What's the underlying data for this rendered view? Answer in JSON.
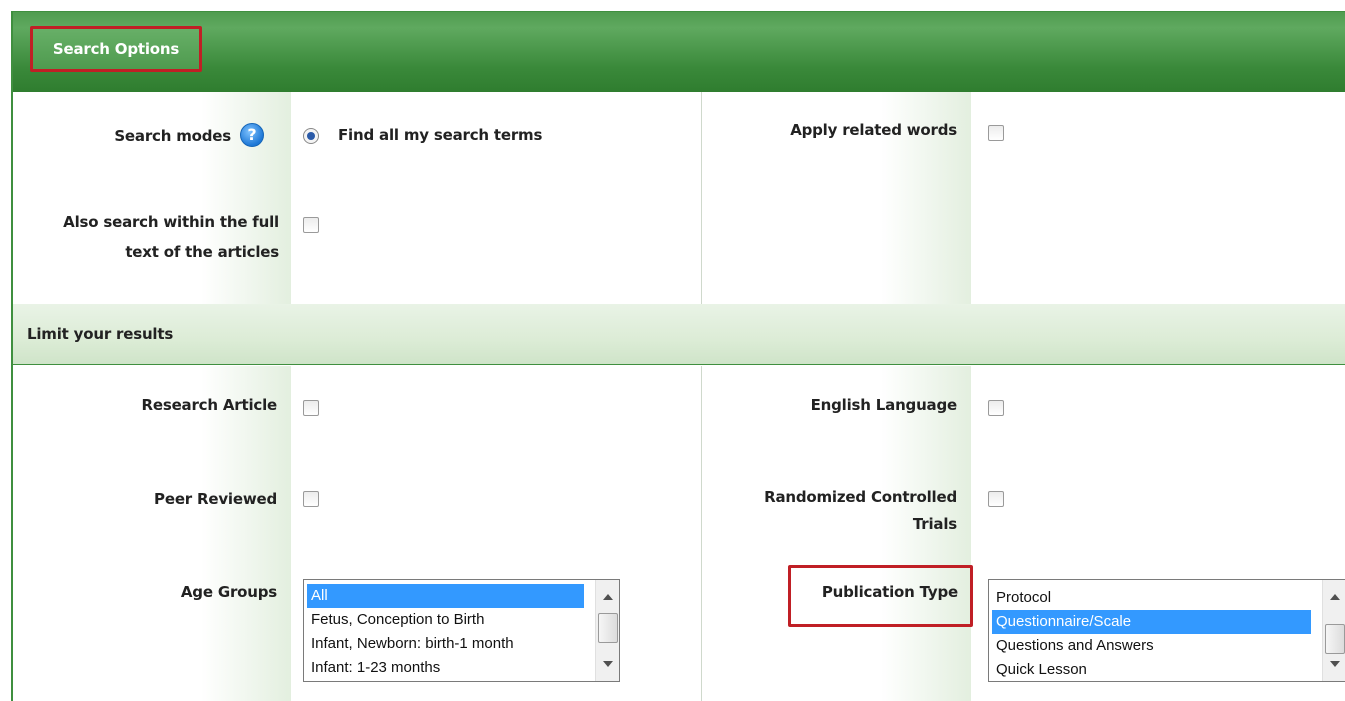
{
  "header": {
    "title": "Search Options"
  },
  "search_modes": {
    "label": "Search modes",
    "radio_label": "Find all my search terms"
  },
  "related_words": {
    "label": "Apply related words"
  },
  "full_text": {
    "label_line1": "Also search within the full",
    "label_line2": "text of the articles"
  },
  "limit_section": {
    "title": "Limit your results"
  },
  "research_article": {
    "label": "Research Article"
  },
  "english_language": {
    "label": "English Language"
  },
  "peer_reviewed": {
    "label": "Peer Reviewed"
  },
  "rct": {
    "label_line1": "Randomized Controlled",
    "label_line2": "Trials"
  },
  "age_groups": {
    "label": "Age Groups",
    "items": [
      "All",
      "Fetus, Conception to Birth",
      "Infant, Newborn: birth-1 month",
      "Infant: 1-23 months"
    ],
    "selected": "All"
  },
  "publication_type": {
    "label": "Publication Type",
    "items": [
      "Protocol",
      "Questionnaire/Scale",
      "Questions and Answers",
      "Quick Lesson"
    ],
    "selected": "Questionnaire/Scale"
  },
  "colors": {
    "header_green": "#3a893a",
    "highlight_red": "#c01f25",
    "select_blue": "#3399ff"
  }
}
